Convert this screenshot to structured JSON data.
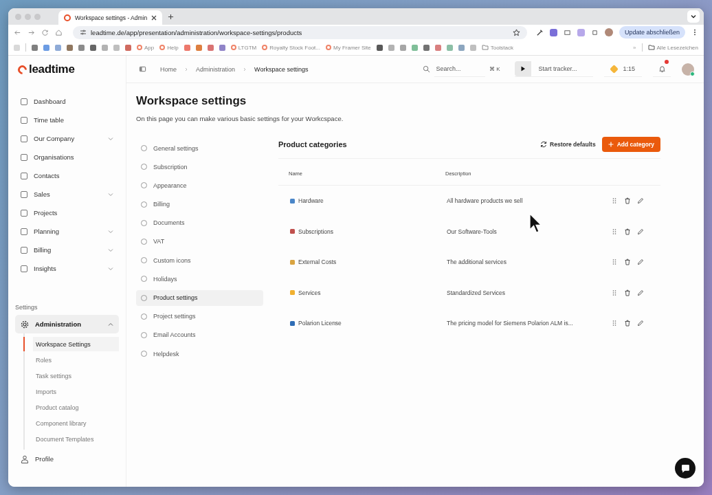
{
  "browser": {
    "tab_title": "Workspace settings - Admin",
    "url": "leadtime.de/app/presentation/administration/workspace-settings/products",
    "update_button": "Update abschließen",
    "bookmarks": [
      {
        "kind": "icon"
      },
      {
        "kind": "icon"
      },
      {
        "kind": "icon"
      },
      {
        "kind": "icon"
      },
      {
        "kind": "icon"
      },
      {
        "kind": "icon"
      },
      {
        "kind": "icon"
      },
      {
        "kind": "icon"
      },
      {
        "kind": "icon"
      },
      {
        "kind": "link",
        "label": "App"
      },
      {
        "kind": "link",
        "label": "Help"
      },
      {
        "kind": "icon"
      },
      {
        "kind": "icon"
      },
      {
        "kind": "icon"
      },
      {
        "kind": "icon"
      },
      {
        "kind": "link",
        "label": "LTGTM"
      },
      {
        "kind": "link",
        "label": "Royalty Stock Foot..."
      },
      {
        "kind": "link",
        "label": "My Framer Site"
      },
      {
        "kind": "icon"
      },
      {
        "kind": "icon"
      },
      {
        "kind": "icon"
      },
      {
        "kind": "icon"
      },
      {
        "kind": "icon"
      },
      {
        "kind": "icon"
      },
      {
        "kind": "icon"
      },
      {
        "kind": "icon"
      },
      {
        "kind": "icon"
      },
      {
        "kind": "folder",
        "label": "Toolstack"
      }
    ],
    "overflow": "»",
    "all_bookmarks": "Alle Lesezeichen"
  },
  "app": {
    "logo": "leadtime",
    "breadcrumbs": [
      "Home",
      "Administration",
      "Workspace settings"
    ],
    "search": {
      "placeholder": "Search...",
      "shortcut": "⌘ K"
    },
    "tracker": {
      "placeholder": "Start tracker..."
    },
    "timer": "1:15",
    "notifications": {
      "unread": true
    }
  },
  "sidebar": {
    "items": [
      {
        "label": "Dashboard",
        "selected": false
      },
      {
        "label": "Time table",
        "selected": false
      },
      {
        "label": "Our Company",
        "expanded": false,
        "selected": false
      },
      {
        "label": "Organisations",
        "selected": false
      },
      {
        "label": "Contacts",
        "selected": false
      },
      {
        "label": "Sales",
        "expanded": false,
        "selected": false
      },
      {
        "label": "Projects",
        "selected": false
      },
      {
        "label": "Planning",
        "expanded": false,
        "selected": false
      },
      {
        "label": "Billing",
        "expanded": false,
        "selected": false
      },
      {
        "label": "Insights",
        "expanded": false,
        "selected": false
      }
    ],
    "section_title": "Settings",
    "admin": {
      "label": "Administration",
      "selected": true,
      "expanded": true,
      "children": [
        {
          "label": "Workspace Settings",
          "selected": true
        },
        {
          "label": "Roles",
          "selected": false
        },
        {
          "label": "Task settings",
          "selected": false
        },
        {
          "label": "Imports",
          "selected": false
        },
        {
          "label": "Product catalog",
          "selected": false
        },
        {
          "label": "Component library",
          "selected": false
        },
        {
          "label": "Document Templates",
          "selected": false
        }
      ]
    },
    "profile": "Profile"
  },
  "page": {
    "title": "Workspace settings",
    "subtitle": "On this page you can make various basic settings for your Workcspace.",
    "settings_menu": [
      {
        "label": "General settings",
        "selected": false
      },
      {
        "label": "Subscription",
        "selected": false
      },
      {
        "label": "Appearance",
        "selected": false
      },
      {
        "label": "Billing",
        "selected": false
      },
      {
        "label": "Documents",
        "selected": false
      },
      {
        "label": "VAT",
        "selected": false
      },
      {
        "label": "Custom icons",
        "selected": false
      },
      {
        "label": "Holidays",
        "selected": false
      },
      {
        "label": "Product settings",
        "selected": true
      },
      {
        "label": "Project settings",
        "selected": false
      },
      {
        "label": "Email Accounts",
        "selected": false
      },
      {
        "label": "Helpdesk",
        "selected": false
      }
    ],
    "panel": {
      "title": "Product categories",
      "restore_button": "Restore defaults",
      "add_button": "Add category",
      "columns": [
        "Name",
        "Description"
      ],
      "rows": [
        {
          "name": "Hardware",
          "description": "All hardware products we sell",
          "color": "#4a86c8"
        },
        {
          "name": "Subscriptions",
          "description": "Our Software-Tools",
          "color": "#c0504d"
        },
        {
          "name": "External Costs",
          "description": "The additional services",
          "color": "#d9a441"
        },
        {
          "name": "Services",
          "description": "Standardized Services",
          "color": "#f0b030"
        },
        {
          "name": "Polarion License",
          "description": "The pricing model for Siemens Polarion ALM is...",
          "color": "#2f6db5"
        }
      ]
    }
  }
}
